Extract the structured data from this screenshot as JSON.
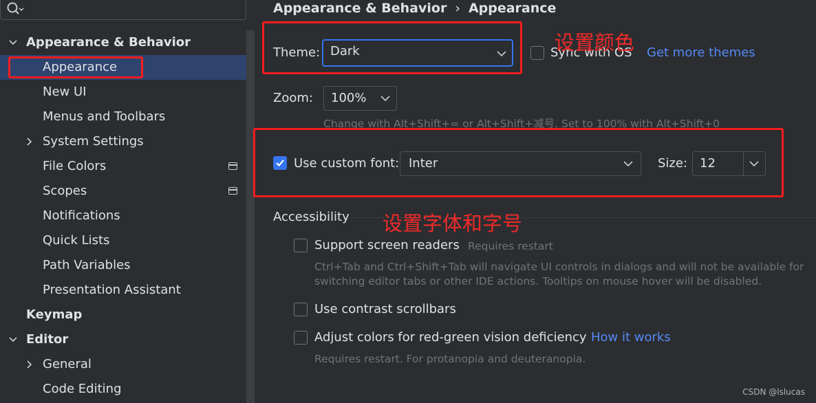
{
  "sidebar": {
    "search": {
      "placeholder": ""
    },
    "items": [
      {
        "label": "Appearance & Behavior",
        "indent": 0,
        "expanded": true
      },
      {
        "label": "Appearance",
        "indent": 1,
        "selected": true
      },
      {
        "label": "New UI",
        "indent": 1
      },
      {
        "label": "Menus and Toolbars",
        "indent": 1
      },
      {
        "label": "System Settings",
        "indent": 1,
        "collapsed": true
      },
      {
        "label": "File Colors",
        "indent": 1,
        "project_icon": true
      },
      {
        "label": "Scopes",
        "indent": 1,
        "project_icon": true
      },
      {
        "label": "Notifications",
        "indent": 1
      },
      {
        "label": "Quick Lists",
        "indent": 1
      },
      {
        "label": "Path Variables",
        "indent": 1
      },
      {
        "label": "Presentation Assistant",
        "indent": 1
      },
      {
        "label": "Keymap",
        "indent": 0
      },
      {
        "label": "Editor",
        "indent": 0,
        "expanded": true
      },
      {
        "label": "General",
        "indent": 1,
        "collapsed": true
      },
      {
        "label": "Code Editing",
        "indent": 1
      }
    ]
  },
  "breadcrumb": {
    "parent": "Appearance & Behavior",
    "current": "Appearance"
  },
  "theme": {
    "label": "Theme:",
    "value": "Dark",
    "sync_label": "Sync with OS",
    "sync_checked": false,
    "more_link": "Get more themes"
  },
  "zoom": {
    "label": "Zoom:",
    "value": "100%",
    "hint": "Change with Alt+Shift+= or Alt+Shift+减号. Set to 100% with Alt+Shift+0"
  },
  "font": {
    "checkbox_label": "Use custom font:",
    "checked": true,
    "value": "Inter",
    "size_label": "Size:",
    "size_value": "12"
  },
  "accessibility": {
    "title": "Accessibility",
    "screen_readers": {
      "label": "Support screen readers",
      "note": "Requires restart",
      "hint_line1": "Ctrl+Tab and Ctrl+Shift+Tab will navigate UI controls in dialogs and will not be available for",
      "hint_line2": "switching editor tabs or other IDE actions. Tooltips on mouse hover will be disabled."
    },
    "contrast_scrollbars": {
      "label": "Use contrast scrollbars"
    },
    "color_deficiency": {
      "label": "Adjust colors for red-green vision deficiency",
      "link": "How it works",
      "hint": "Requires restart. For protanopia and deuteranopia."
    }
  },
  "annotations": {
    "color_note": "设置颜色",
    "font_note": "设置字体和字号"
  },
  "watermark": "CSDN @lslucas",
  "colors": {
    "background": "#2b2d30",
    "selection": "#2e436e",
    "accent": "#3574f0",
    "link": "#548af7",
    "annotation": "#f51d1d"
  }
}
